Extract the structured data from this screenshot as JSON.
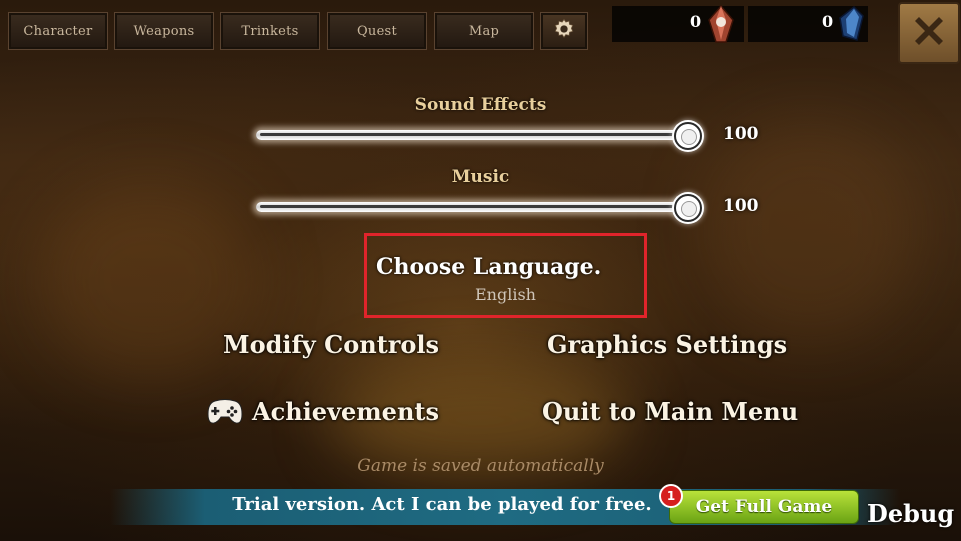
{
  "tabs": [
    {
      "label": "Character"
    },
    {
      "label": "Weapons"
    },
    {
      "label": "Trinkets"
    },
    {
      "label": "Quest"
    },
    {
      "label": "Map"
    }
  ],
  "icons": {
    "settings": "gear-icon",
    "close": "close-icon",
    "red_gem": "red-crystal-icon",
    "blue_gem": "blue-shard-icon",
    "achievements": "gamepad-icon"
  },
  "currency": {
    "red_value": "0",
    "blue_value": "0"
  },
  "settings": {
    "sound_effects": {
      "label": "Sound Effects",
      "value": "100",
      "level": 100
    },
    "music": {
      "label": "Music",
      "value": "100",
      "level": 100
    }
  },
  "language": {
    "title": "Choose Language.",
    "current": "English"
  },
  "menu": {
    "modify_controls": "Modify Controls",
    "graphics_settings": "Graphics Settings",
    "achievements": "Achievements",
    "quit": "Quit to Main Menu"
  },
  "saved_note": "Game is saved automatically",
  "banner": {
    "text": "Trial version. Act I can be played for free.",
    "button": "Get Full Game",
    "badge": "1"
  },
  "debug_label": "Debug",
  "colors": {
    "highlight_border": "#e0242b",
    "button_green": "#8cc423",
    "banner_teal": "#1f6b82"
  }
}
